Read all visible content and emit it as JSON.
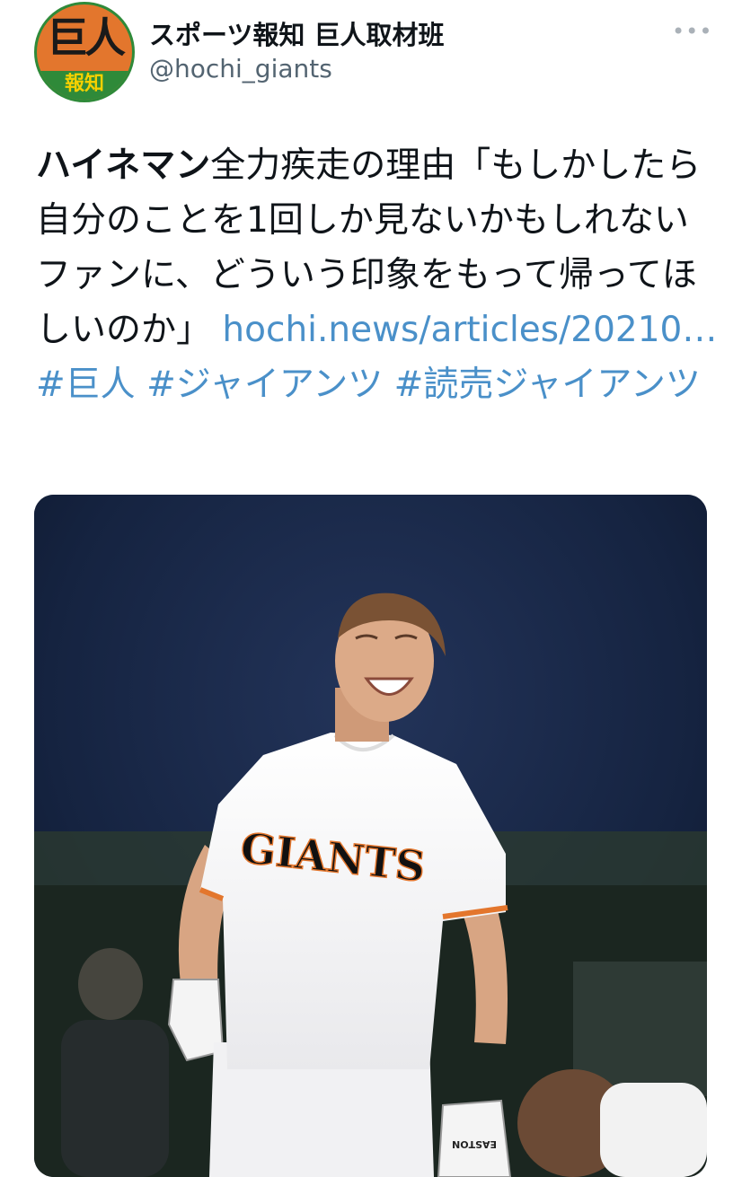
{
  "account": {
    "display_name": "スポーツ報知 巨人取材班",
    "handle": "@hochi_giants",
    "avatar_mark": "巨人",
    "avatar_band": "報知"
  },
  "tweet": {
    "bold_lead": "ハイネマン",
    "text": "全力疾走の理由「もしかしたら自分のことを1回しか見ないかもしれないファンに、どういう印象をもって帰ってほしいのか」",
    "link": "hochi.news/articles/20210…",
    "hashtags": [
      "#巨人",
      "#ジャイアンツ",
      "#読売ジャイアンツ"
    ]
  },
  "media": {
    "jersey_text": "GIANTS",
    "glove_brand": "EASTON"
  },
  "colors": {
    "link": "#4a90c9",
    "avatar_orange": "#e3762d",
    "avatar_green": "#2f8a39"
  }
}
